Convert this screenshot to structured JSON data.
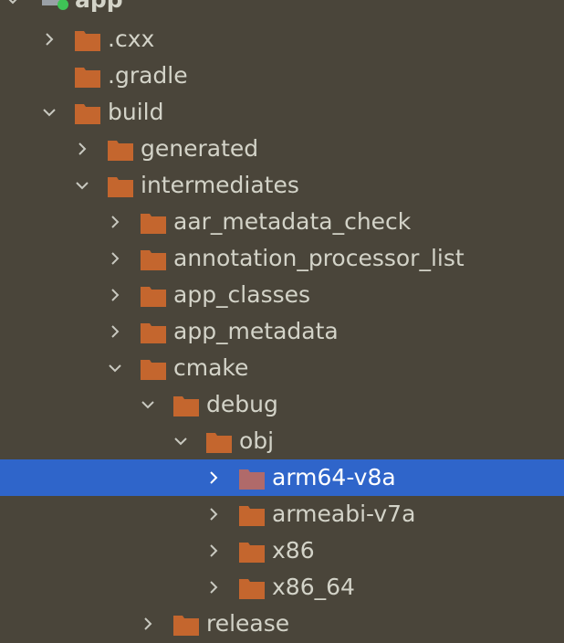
{
  "root": {
    "label": "app"
  },
  "colors": {
    "background": "#4a453a",
    "selection": "#2f65ca",
    "folder": "#c4662e",
    "folder_selected": "#b06a6a",
    "chevron": "#c9c9c0",
    "module_badge": "#3fc456"
  },
  "items": [
    {
      "label": ".cxx",
      "depth": 0,
      "expand": "collapsed"
    },
    {
      "label": ".gradle",
      "depth": 0,
      "expand": "none"
    },
    {
      "label": "build",
      "depth": 0,
      "expand": "expanded"
    },
    {
      "label": "generated",
      "depth": 1,
      "expand": "collapsed"
    },
    {
      "label": "intermediates",
      "depth": 1,
      "expand": "expanded"
    },
    {
      "label": "aar_metadata_check",
      "depth": 2,
      "expand": "collapsed"
    },
    {
      "label": "annotation_processor_list",
      "depth": 2,
      "expand": "collapsed"
    },
    {
      "label": "app_classes",
      "depth": 2,
      "expand": "collapsed"
    },
    {
      "label": "app_metadata",
      "depth": 2,
      "expand": "collapsed"
    },
    {
      "label": "cmake",
      "depth": 2,
      "expand": "expanded"
    },
    {
      "label": "debug",
      "depth": 3,
      "expand": "expanded"
    },
    {
      "label": "obj",
      "depth": 4,
      "expand": "expanded"
    },
    {
      "label": "arm64-v8a",
      "depth": 5,
      "expand": "collapsed",
      "selected": true
    },
    {
      "label": "armeabi-v7a",
      "depth": 5,
      "expand": "collapsed"
    },
    {
      "label": "x86",
      "depth": 5,
      "expand": "collapsed"
    },
    {
      "label": "x86_64",
      "depth": 5,
      "expand": "collapsed"
    },
    {
      "label": "release",
      "depth": 3,
      "expand": "collapsed"
    }
  ]
}
